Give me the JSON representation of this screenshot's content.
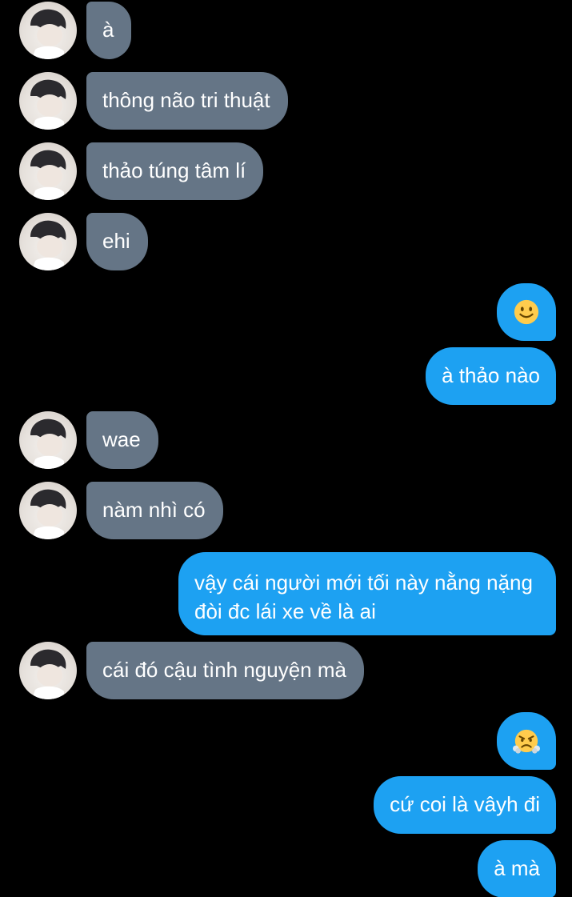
{
  "conversation": {
    "messages": [
      {
        "direction": "incoming",
        "text": "à"
      },
      {
        "direction": "incoming",
        "text": "thông não tri thuật"
      },
      {
        "direction": "incoming",
        "text": "thảo túng tâm lí"
      },
      {
        "direction": "incoming",
        "text": "ehi"
      },
      {
        "direction": "outgoing",
        "emoji": "slightly-smiling-face-icon"
      },
      {
        "direction": "outgoing",
        "text": "à thảo nào"
      },
      {
        "direction": "incoming",
        "text": "wae"
      },
      {
        "direction": "incoming",
        "text": "nàm nhì có"
      },
      {
        "direction": "outgoing",
        "text": "vậy cái người mới tối này nằng nặng đòi đc lái xe về là ai"
      },
      {
        "direction": "incoming",
        "text": "cái đó cậu tình nguyện mà"
      },
      {
        "direction": "outgoing",
        "emoji": "face-with-steam-icon"
      },
      {
        "direction": "outgoing",
        "text": "cứ coi là vâyh đi"
      },
      {
        "direction": "outgoing",
        "text": "à mà"
      }
    ]
  },
  "colors": {
    "background": "#000000",
    "incoming_bubble": "#657586",
    "outgoing_bubble": "#1da1f2",
    "text": "#ffffff"
  }
}
